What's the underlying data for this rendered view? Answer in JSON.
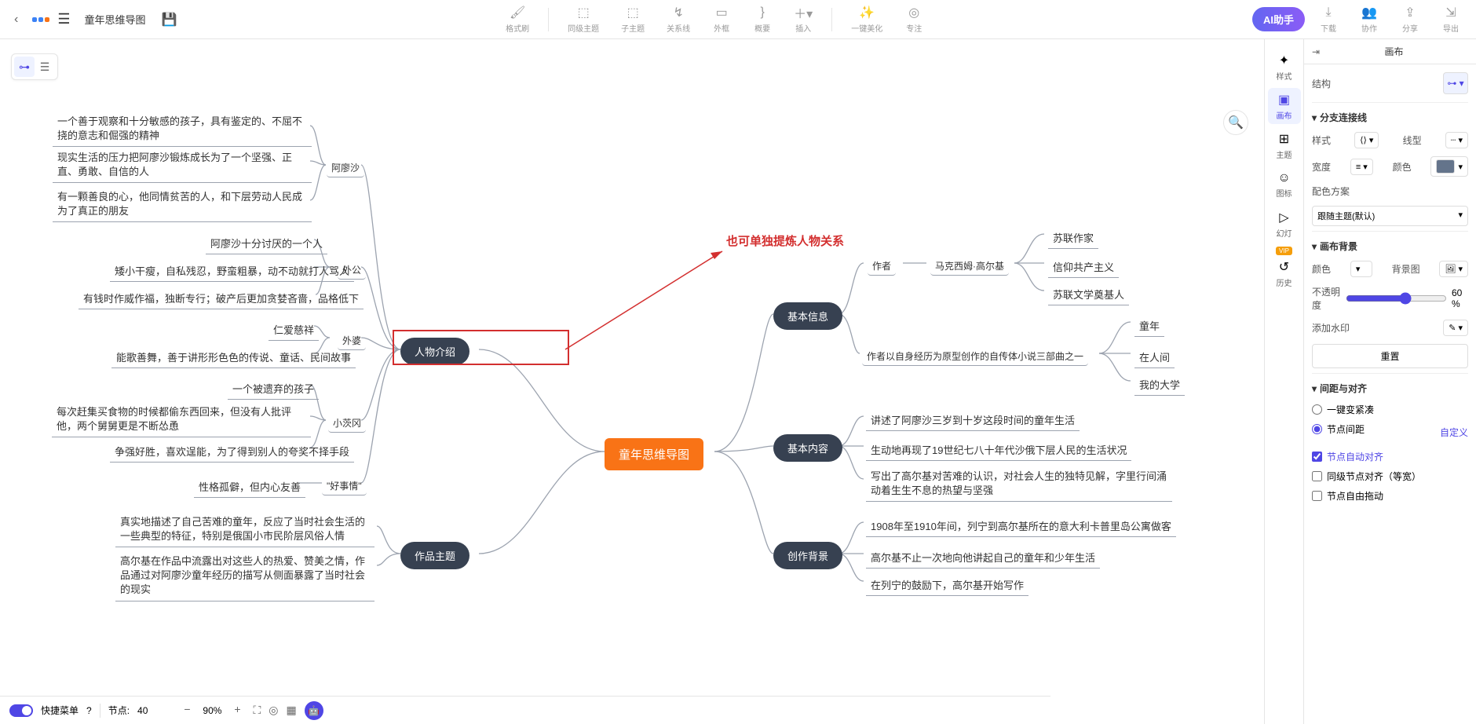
{
  "doc_title": "童年思维导图",
  "toolbar": {
    "format": "格式刷",
    "peer": "同级主题",
    "child": "子主题",
    "relation": "关系线",
    "frame": "外框",
    "summary": "概要",
    "insert": "插入",
    "beautify": "一键美化",
    "focus": "专注",
    "ai": "AI助手",
    "download": "下载",
    "collab": "协作",
    "share": "分享",
    "export": "导出"
  },
  "annotation": "也可单独提炼人物关系",
  "mindmap": {
    "center": "童年思维导图",
    "left": [
      {
        "name": "人物介绍",
        "children": [
          {
            "name": "阿廖沙",
            "children": [
              "一个善于观察和十分敏感的孩子，具有鉴定的、不屈不挠的意志和倔强的精神",
              "现实生活的压力把阿廖沙锻炼成长为了一个坚强、正直、勇敢、自信的人",
              "有一颗善良的心，他同情贫苦的人，和下层劳动人民成为了真正的朋友"
            ]
          },
          {
            "name": "外公",
            "children": [
              "阿廖沙十分讨厌的一个人",
              "矮小干瘦，自私残忍，野蛮粗暴，动不动就打人骂人",
              "有钱时作威作福，独断专行；破产后更加贪婪吝啬，品格低下"
            ]
          },
          {
            "name": "外婆",
            "children": [
              "仁爱慈祥",
              "能歌善舞，善于讲形形色色的传说、童话、民间故事"
            ]
          },
          {
            "name": "小茨冈",
            "children": [
              "一个被遗弃的孩子",
              "每次赶集买食物的时候都偷东西回来，但没有人批评他，两个舅舅更是不断怂恿",
              "争强好胜，喜欢逞能，为了得到别人的夸奖不择手段"
            ]
          },
          {
            "name": "\"好事情\"",
            "children": [
              "性格孤僻，但内心友善"
            ]
          }
        ]
      },
      {
        "name": "作品主题",
        "children": [
          "真实地描述了自己苦难的童年，反应了当时社会生活的一些典型的特征，特别是俄国小市民阶层风俗人情",
          "高尔基在作品中流露出对这些人的热爱、赞美之情，作品通过对阿廖沙童年经历的描写从侧面暴露了当时社会的现实"
        ]
      }
    ],
    "right": [
      {
        "name": "基本信息",
        "children": [
          {
            "name": "作者",
            "sub": "马克西姆·高尔基",
            "children": [
              "苏联作家",
              "信仰共产主义",
              "苏联文学奠基人"
            ]
          },
          {
            "name": "作者以自身经历为原型创作的自传体小说三部曲之一",
            "children": [
              "童年",
              "在人间",
              "我的大学"
            ]
          }
        ]
      },
      {
        "name": "基本内容",
        "children": [
          "讲述了阿廖沙三岁到十岁这段时间的童年生活",
          "生动地再现了19世纪七八十年代沙俄下层人民的生活状况",
          "写出了高尔基对苦难的认识，对社会人生的独特见解，字里行间涌动着生生不息的热望与坚强"
        ]
      },
      {
        "name": "创作背景",
        "children": [
          "1908年至1910年间，列宁到高尔基所在的意大利卡普里岛公寓做客",
          "高尔基不止一次地向他讲起自己的童年和少年生活",
          "在列宁的鼓励下，高尔基开始写作"
        ]
      }
    ]
  },
  "side_tabs": [
    "样式",
    "画布",
    "主题",
    "图标",
    "幻灯",
    "历史"
  ],
  "panel": {
    "title": "画布",
    "structure": "结构",
    "branch_section": "分支连接线",
    "style": "样式",
    "line_type": "线型",
    "width": "宽度",
    "color": "颜色",
    "color_scheme_label": "配色方案",
    "color_scheme_value": "跟随主题(默认)",
    "bg_section": "画布背景",
    "bg_color": "颜色",
    "bg_image": "背景图",
    "opacity": "不透明度",
    "opacity_val": "60 %",
    "watermark": "添加水印",
    "reset": "重置",
    "spacing_section": "间距与对齐",
    "compact": "一键变紧凑",
    "node_spacing": "节点间距",
    "custom": "自定义",
    "auto_align": "节点自动对齐",
    "peer_align": "同级节点对齐（等宽）",
    "free_drag": "节点自由拖动"
  },
  "bottom": {
    "shortcut": "快捷菜单",
    "nodes_label": "节点:",
    "nodes_count": "40",
    "zoom": "90%"
  }
}
